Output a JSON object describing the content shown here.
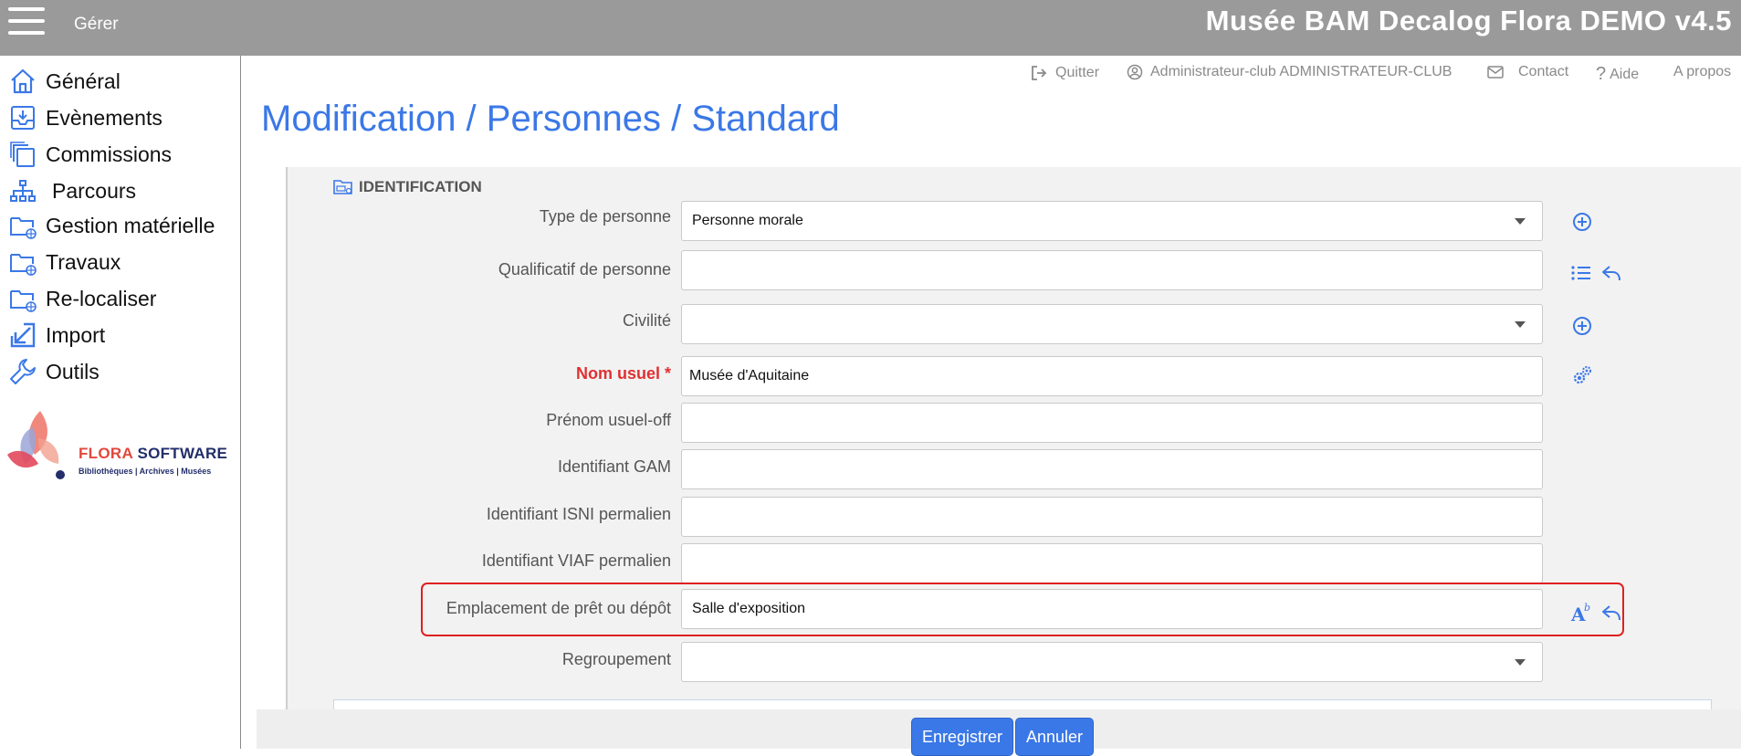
{
  "topbar": {
    "manage_label": "Gérer",
    "app_title": "Musée BAM Decalog Flora DEMO v4.5",
    "bg_color": "#9a9a9a"
  },
  "sidebar": {
    "items": [
      {
        "label": "Général",
        "icon": "home-icon"
      },
      {
        "label": "Evènements",
        "icon": "inbox-download-icon"
      },
      {
        "label": "Commissions",
        "icon": "copy-stack-icon"
      },
      {
        "label": "Parcours",
        "icon": "sitemap-icon"
      },
      {
        "label": "Gestion matérielle",
        "icon": "folder-globe-icon"
      },
      {
        "label": "Travaux",
        "icon": "folder-globe-icon"
      },
      {
        "label": "Re-localiser",
        "icon": "folder-globe-icon"
      },
      {
        "label": "Import",
        "icon": "import-arrow-icon"
      },
      {
        "label": "Outils",
        "icon": "wrench-icon"
      }
    ],
    "logo": {
      "brand_part1": "FLORA ",
      "brand_part2": "SOFTWARE",
      "tagline": "Bibliothèques | Archives | Musées"
    }
  },
  "header_links": {
    "quit": "Quitter",
    "user": "Administrateur-club ADMINISTRATEUR-CLUB",
    "contact": "Contact",
    "help": "Aide",
    "about": "A propos"
  },
  "page_title": "Modification / Personnes / Standard",
  "section": {
    "title": "IDENTIFICATION"
  },
  "form": {
    "type_personne": {
      "label": "Type de personne",
      "value": "Personne morale"
    },
    "qualificatif": {
      "label": "Qualificatif de personne",
      "value": ""
    },
    "civilite": {
      "label": "Civilité",
      "value": ""
    },
    "nom_usuel": {
      "label": "Nom usuel *",
      "value": "Musée d'Aquitaine"
    },
    "prenom_usuel": {
      "label": "Prénom usuel-off",
      "value": ""
    },
    "identifiant_gam": {
      "label": "Identifiant GAM",
      "value": ""
    },
    "identifiant_isni": {
      "label": "Identifiant ISNI permalien",
      "value": ""
    },
    "identifiant_viaf": {
      "label": "Identifiant VIAF permalien",
      "value": ""
    },
    "emplacement": {
      "label": "Emplacement de prêt ou dépôt",
      "value": "Salle d'exposition"
    },
    "regroupement": {
      "label": "Regroupement",
      "value": ""
    }
  },
  "buttons": {
    "save": "Enregistrer",
    "cancel": "Annuler"
  },
  "colors": {
    "accent": "#3b78e7",
    "required": "#e03131",
    "highlight": "#e02020"
  }
}
